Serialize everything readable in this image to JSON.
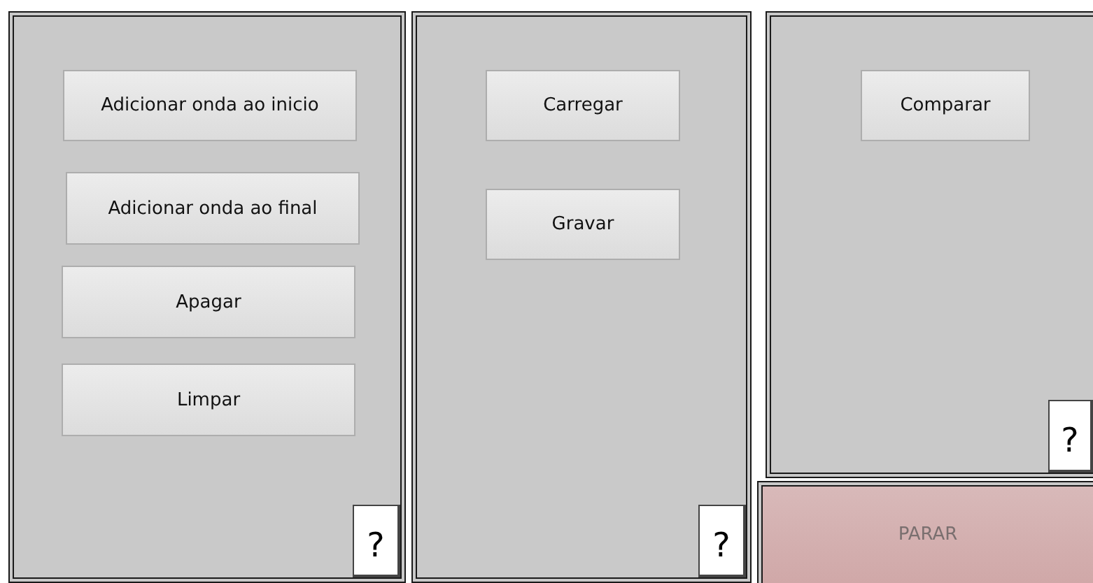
{
  "panels": [
    {
      "buttons": [
        "Adicionar onda ao inicio",
        "Adicionar onda ao final",
        "Apagar",
        "Limpar"
      ],
      "help": "?"
    },
    {
      "buttons": [
        "Carregar",
        "Gravar"
      ],
      "help": "?"
    },
    {
      "buttons": [
        "Comparar"
      ],
      "help": "?"
    }
  ],
  "stop_button": {
    "label": "PARAR",
    "disabled": true
  }
}
